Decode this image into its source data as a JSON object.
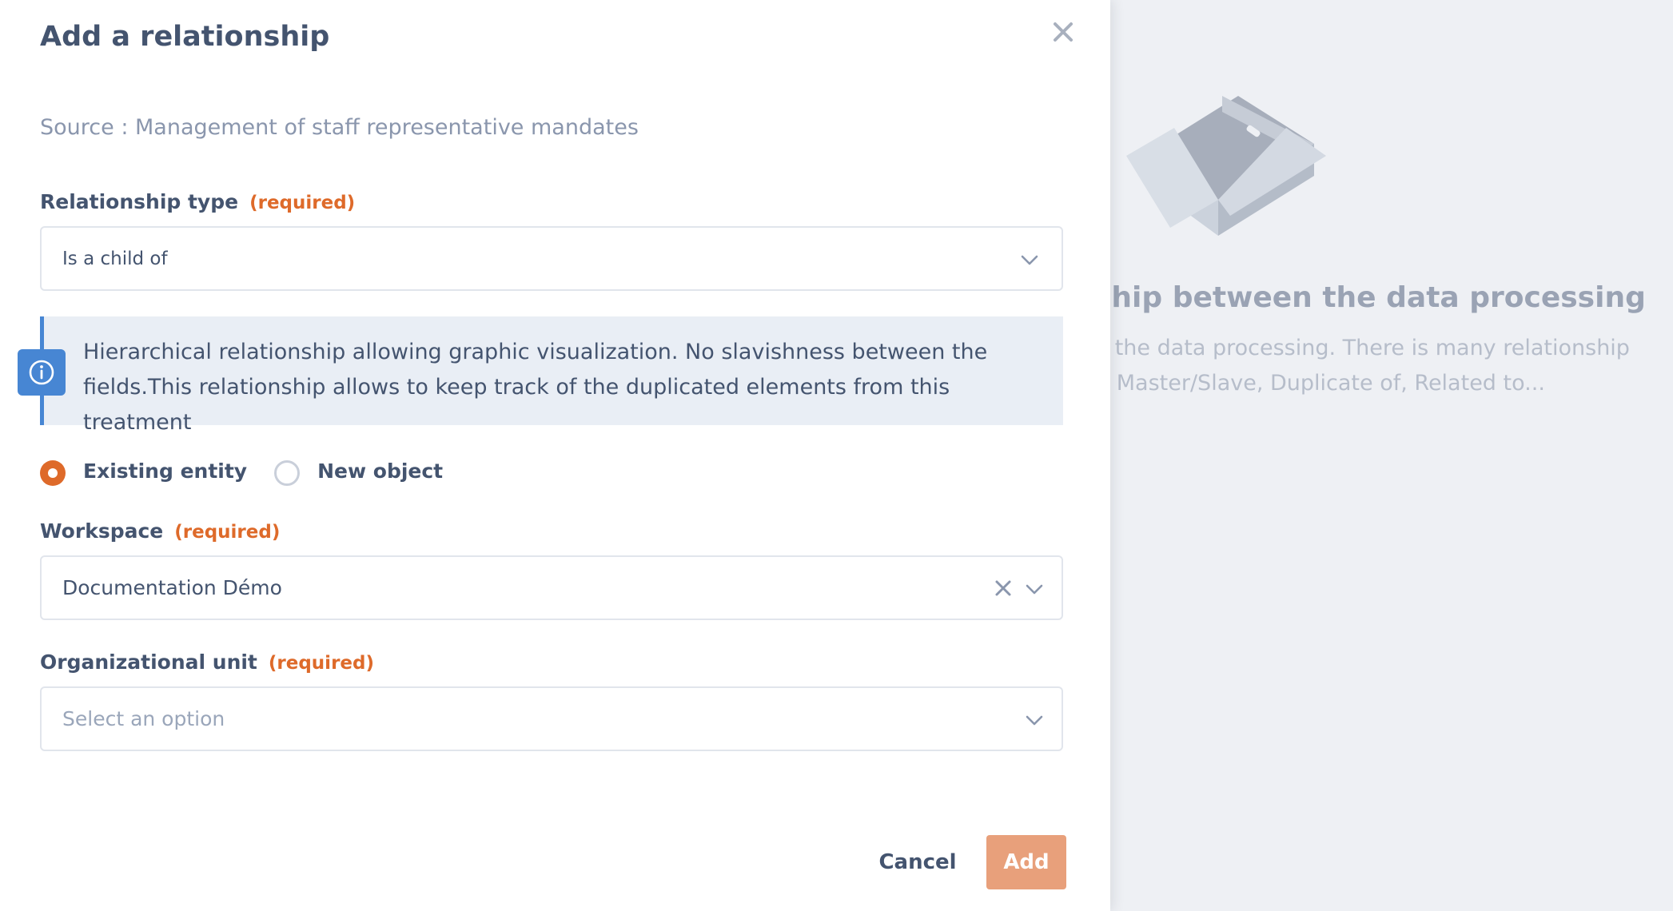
{
  "modal": {
    "title": "Add a relationship",
    "source": "Source : Management of staff representative mandates"
  },
  "relationship_type": {
    "label": "Relationship type",
    "required": "(required)",
    "value": "Is a child of"
  },
  "info": {
    "text": "Hierarchical relationship allowing graphic visualization. No slavishness between the fields.This relationship allows to keep track of the duplicated elements from this treatment"
  },
  "target_mode": {
    "options": [
      {
        "label": "Existing entity",
        "checked": true
      },
      {
        "label": "New object",
        "checked": false
      }
    ]
  },
  "workspace": {
    "label": "Workspace",
    "required": "(required)",
    "value": "Documentation Démo"
  },
  "org_unit": {
    "label": "Organizational unit",
    "required": "(required)",
    "placeholder": "Select an option"
  },
  "actions": {
    "cancel": "Cancel",
    "add": "Add"
  },
  "background": {
    "title_fragment": "ship between the data processing",
    "desc_line1": "n the data processing. There is many relationship",
    "desc_line2": "t, Master/Slave, Duplicate of, Related to..."
  },
  "colors": {
    "accent": "#de6a2a",
    "add_button": "#e8a07b",
    "info_blue": "#4786d3",
    "info_bg": "#e9eef5",
    "text": "#44546f"
  },
  "icons": [
    "close-icon",
    "chevron-down-icon",
    "info-icon",
    "clear-icon",
    "empty-box-illustration"
  ]
}
